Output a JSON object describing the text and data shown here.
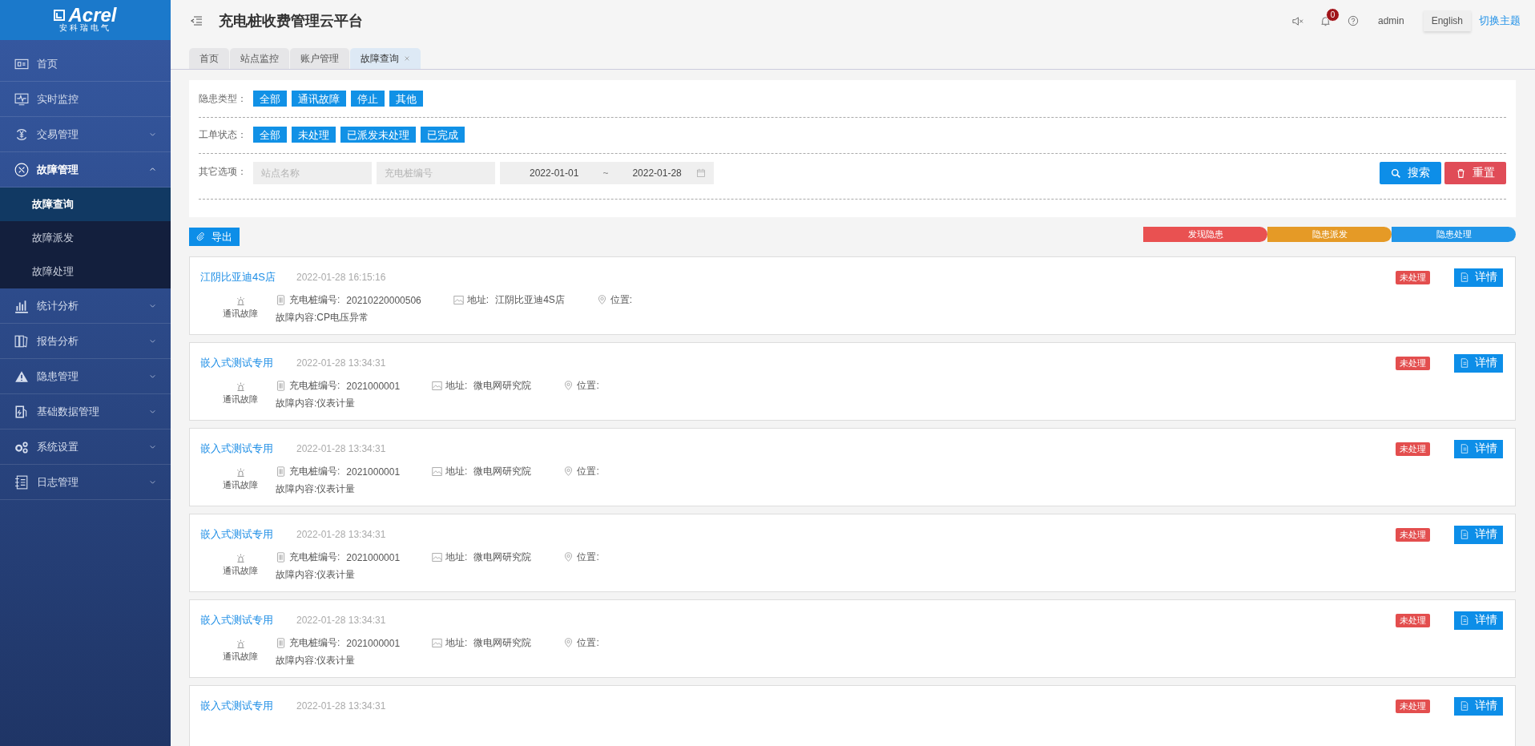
{
  "logo": {
    "name": "Acrel",
    "subtitle": "安科瑞电气"
  },
  "sidebar": {
    "items": [
      {
        "label": "首页",
        "expandable": false
      },
      {
        "label": "实时监控",
        "expandable": false
      },
      {
        "label": "交易管理",
        "expandable": true,
        "expanded": false
      },
      {
        "label": "故障管理",
        "expandable": true,
        "expanded": true,
        "children": [
          {
            "label": "故障查询",
            "selected": true
          },
          {
            "label": "故障派发",
            "selected": false
          },
          {
            "label": "故障处理",
            "selected": false
          }
        ]
      },
      {
        "label": "统计分析",
        "expandable": true,
        "expanded": false
      },
      {
        "label": "报告分析",
        "expandable": true,
        "expanded": false
      },
      {
        "label": "隐患管理",
        "expandable": true,
        "expanded": false
      },
      {
        "label": "基础数据管理",
        "expandable": true,
        "expanded": false
      },
      {
        "label": "系统设置",
        "expandable": true,
        "expanded": false
      },
      {
        "label": "日志管理",
        "expandable": true,
        "expanded": false
      }
    ]
  },
  "header": {
    "title": "充电桩收费管理云平台",
    "notification_count": "0",
    "user": "admin",
    "language": "English",
    "language_hovered": true,
    "theme_link": "切换主题"
  },
  "tabs": [
    {
      "label": "首页",
      "selected": false,
      "closable": false
    },
    {
      "label": "站点监控",
      "selected": false,
      "closable": false
    },
    {
      "label": "账户管理",
      "selected": false,
      "closable": false
    },
    {
      "label": "故障查询",
      "selected": true,
      "closable": true
    }
  ],
  "filters": {
    "hazard_type": {
      "label": "隐患类型：",
      "options": [
        "全部",
        "通讯故障",
        "停止",
        "其他"
      ]
    },
    "order_status": {
      "label": "工单状态：",
      "options": [
        "全部",
        "未处理",
        "已派发未处理",
        "已完成"
      ]
    },
    "other": {
      "label": "其它选项：",
      "station_placeholder": "站点名称",
      "pile_placeholder": "充电桩编号",
      "date_from": "2022-01-01",
      "separator": "~",
      "date_to": "2022-01-28"
    },
    "search_button": "搜索",
    "reset_button": "重置"
  },
  "export_button": "导出",
  "process_steps": [
    {
      "label": "发现隐患",
      "color": "#e95151"
    },
    {
      "label": "隐患派发",
      "color": "#e59a26"
    },
    {
      "label": "隐患处理",
      "color": "#2196e8"
    }
  ],
  "faults": [
    {
      "station": "江阴比亚迪4S店",
      "time": "2022-01-28 16:15:16",
      "type": "通讯故障",
      "pile_label": "充电桩编号:",
      "pile_no": "20210220000506",
      "address_label": "地址:",
      "address": "江阴比亚迪4S店",
      "location_label": "位置:",
      "content": "故障内容:CP电压异常",
      "status": "未处理",
      "detail_button": "详情"
    },
    {
      "station": "嵌入式测试专用",
      "time": "2022-01-28 13:34:31",
      "type": "通讯故障",
      "pile_label": "充电桩编号:",
      "pile_no": "2021000001",
      "address_label": "地址:",
      "address": "微电网研究院",
      "location_label": "位置:",
      "content": "故障内容:仪表计量",
      "status": "未处理",
      "detail_button": "详情"
    },
    {
      "station": "嵌入式测试专用",
      "time": "2022-01-28 13:34:31",
      "type": "通讯故障",
      "pile_label": "充电桩编号:",
      "pile_no": "2021000001",
      "address_label": "地址:",
      "address": "微电网研究院",
      "location_label": "位置:",
      "content": "故障内容:仪表计量",
      "status": "未处理",
      "detail_button": "详情"
    },
    {
      "station": "嵌入式测试专用",
      "time": "2022-01-28 13:34:31",
      "type": "通讯故障",
      "pile_label": "充电桩编号:",
      "pile_no": "2021000001",
      "address_label": "地址:",
      "address": "微电网研究院",
      "location_label": "位置:",
      "content": "故障内容:仪表计量",
      "status": "未处理",
      "detail_button": "详情"
    },
    {
      "station": "嵌入式测试专用",
      "time": "2022-01-28 13:34:31",
      "type": "通讯故障",
      "pile_label": "充电桩编号:",
      "pile_no": "2021000001",
      "address_label": "地址:",
      "address": "微电网研究院",
      "location_label": "位置:",
      "content": "故障内容:仪表计量",
      "status": "未处理",
      "detail_button": "详情"
    },
    {
      "station": "嵌入式测试专用",
      "time": "2022-01-28 13:34:31",
      "status": "未处理",
      "detail_button": "详情"
    }
  ]
}
